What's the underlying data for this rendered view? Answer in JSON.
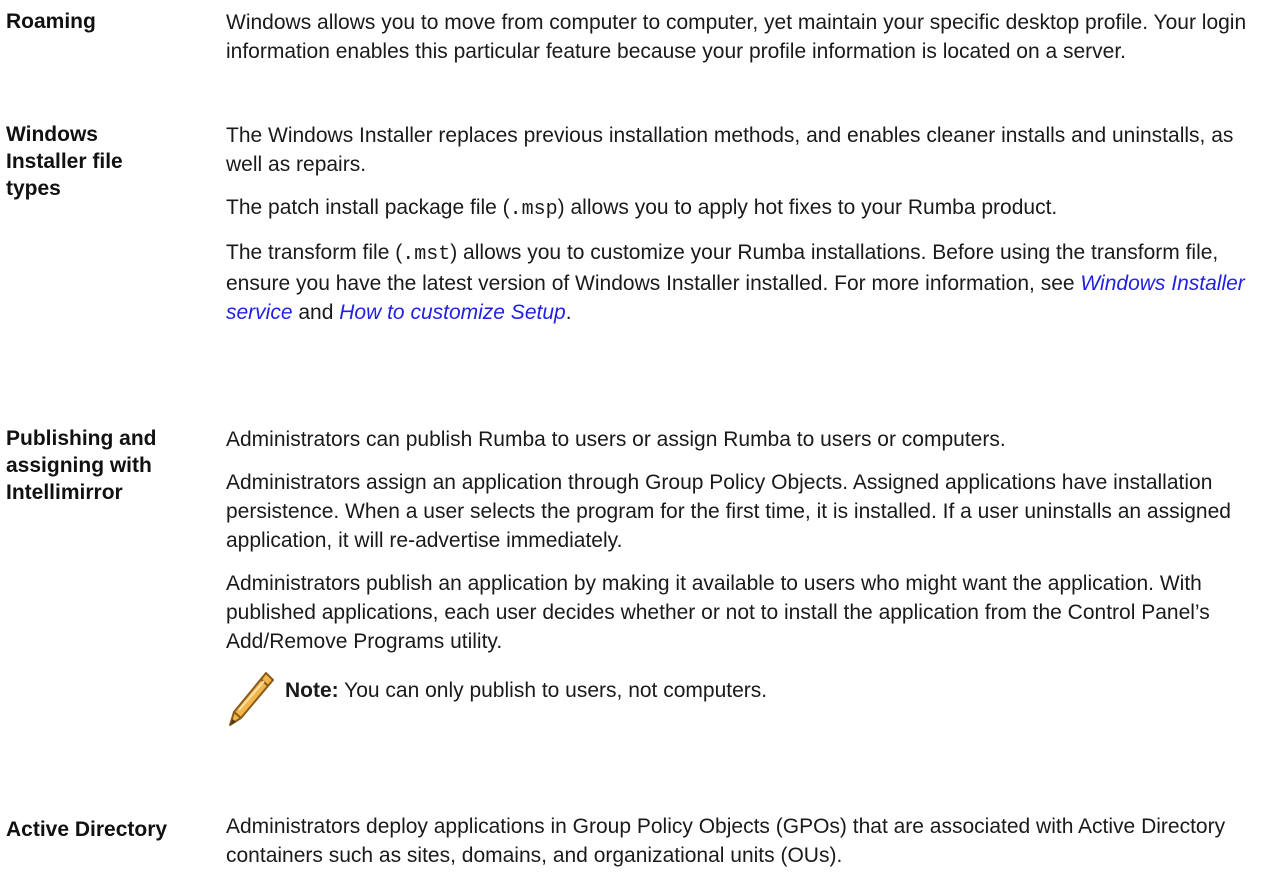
{
  "roaming": {
    "term": "Roaming",
    "def": "Windows allows you to move from computer to computer, yet maintain your specific desktop profile. Your login information enables this particular feature because your profile information is located on a server."
  },
  "installer": {
    "term": "Windows Installer file types",
    "p1": "The Windows Installer replaces previous installation methods, and enables cleaner installs and uninstalls, as well as repairs.",
    "p2_before": "The patch install package file (",
    "p2_code": ".msp",
    "p2_after": ") allows you to apply hot fixes to your Rumba product.",
    "p3_before": "The transform file (",
    "p3_code": ".mst",
    "p3_after": ") allows you to customize your Rumba installations. Before using the transform file, ensure you have the latest version of Windows Installer installed. For more information, see ",
    "link1": "Windows Installer service",
    "p3_and": " and ",
    "link2": "How to customize Setup",
    "p3_end": "."
  },
  "publishing": {
    "term": "Publishing and assigning with Intellimirror",
    "p1": "Administrators can publish Rumba to users or assign Rumba to users or computers.",
    "p2": "Administrators assign an application through Group Policy Objects. Assigned applications have installation persistence. When a user selects the program for the first time, it is installed. If a user uninstalls an assigned application, it will re-advertise immediately.",
    "p3": "Administrators publish an application by making it available to users who might want the application. With published applications, each user decides whether or not to install the application from the Control Panel’s Add/Remove Programs utility.",
    "note_icon": "pencil-icon",
    "note_label": "Note:",
    "note_text": " You can only publish to users, not computers."
  },
  "active_directory": {
    "term": "Active Directory",
    "def": "Administrators deploy applications in Group Policy Objects (GPOs) that are associated with Active Directory containers such as sites, domains, and organizational units (OUs)."
  },
  "colors": {
    "link": "#1f1fe6",
    "pencil_outline": "#8a5a1a",
    "pencil_body": "#f2b64b"
  }
}
